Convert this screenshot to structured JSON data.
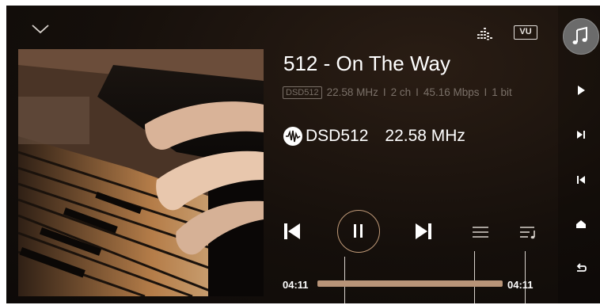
{
  "track": {
    "title": "512 - On The Way",
    "badge": "DSD512",
    "sample_rate": "22.58 MHz",
    "channels": "2 ch",
    "bitrate": "45.16 Mbps",
    "bit_depth": "1 bit",
    "separator": "I"
  },
  "format": {
    "label": "DSD512",
    "frequency": "22.58 MHz"
  },
  "toolbar": {
    "vu_label": "VU",
    "icons": [
      "chevron-down-icon",
      "equalizer-icon",
      "vu-meter-icon",
      "music-note-icon"
    ]
  },
  "sidebar": {
    "icons": [
      "play-icon",
      "skip-next-icon",
      "skip-previous-icon",
      "home-icon",
      "back-icon"
    ]
  },
  "controls": {
    "icons": [
      "skip-previous-icon",
      "pause-icon",
      "skip-next-icon",
      "queue-icon",
      "playlist-icon"
    ]
  },
  "progress": {
    "elapsed": "04:11",
    "total": "04:11",
    "fraction": 1.0
  },
  "colors": {
    "background": "#150f0b",
    "accent": "#b89478",
    "muted_text": "#7a7068",
    "primary_text": "#ffffff"
  }
}
